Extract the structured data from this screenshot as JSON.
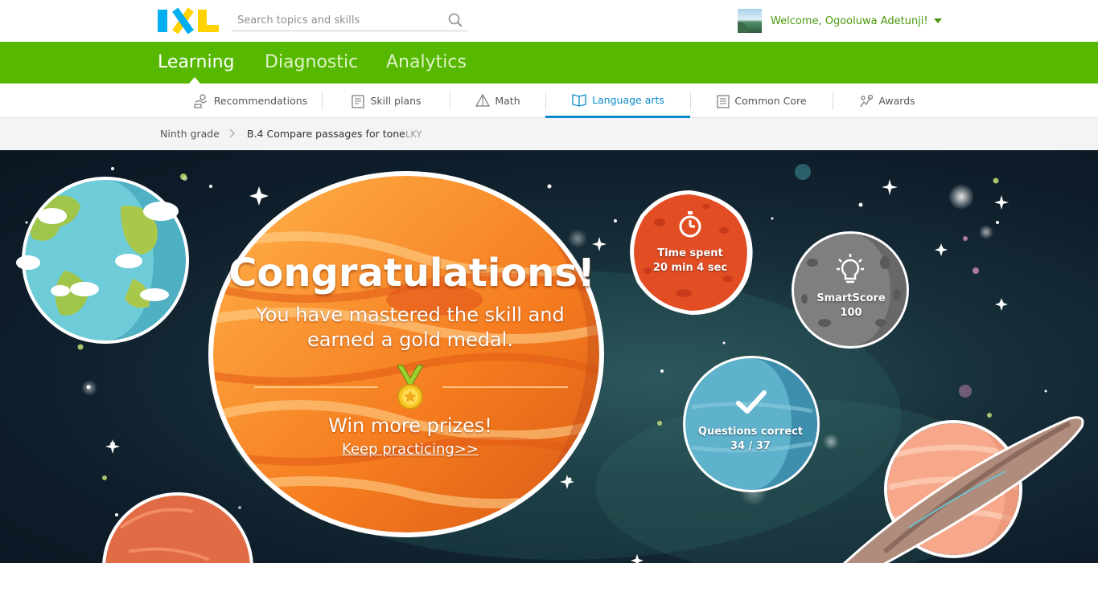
{
  "header": {
    "logo_text": "IXL",
    "search": {
      "placeholder": "Search topics and skills",
      "value": ""
    },
    "welcome": "Welcome, Ogooluwa Adetunji!"
  },
  "main_nav": {
    "tabs": [
      {
        "label": "Learning",
        "active": true
      },
      {
        "label": "Diagnostic",
        "active": false
      },
      {
        "label": "Analytics",
        "active": false
      }
    ]
  },
  "sub_nav": {
    "tabs": [
      {
        "label": "Recommendations",
        "icon": "recommendations-icon"
      },
      {
        "label": "Skill plans",
        "icon": "skill-plans-icon"
      },
      {
        "label": "Math",
        "icon": "math-icon"
      },
      {
        "label": "Language arts",
        "icon": "language-arts-icon",
        "active": true
      },
      {
        "label": "Common Core",
        "icon": "common-core-icon"
      },
      {
        "label": "Awards",
        "icon": "awards-icon"
      }
    ]
  },
  "breadcrumb": {
    "grade": "Ninth grade",
    "skill": "B.4 Compare passages for tone",
    "code": "LKY"
  },
  "banner": {
    "title": "Congratulations!",
    "message": "You have mastered the skill and earned a gold medal.",
    "prize_text": "Win more prizes!",
    "link_text": "Keep practicing>>",
    "medal_icon": "gold-medal-icon"
  },
  "stats": {
    "time": {
      "label": "Time spent",
      "value": "20 min 4 sec",
      "icon": "stopwatch-icon"
    },
    "smartscore": {
      "label": "SmartScore",
      "value": "100",
      "icon": "lightbulb-icon"
    },
    "questions": {
      "label": "Questions correct",
      "value": "34 / 37",
      "icon": "checkmark-icon"
    }
  },
  "colors": {
    "brand_green": "#56b800",
    "active_blue": "#0a8ac9",
    "welcome_green": "#4a9a0e"
  }
}
